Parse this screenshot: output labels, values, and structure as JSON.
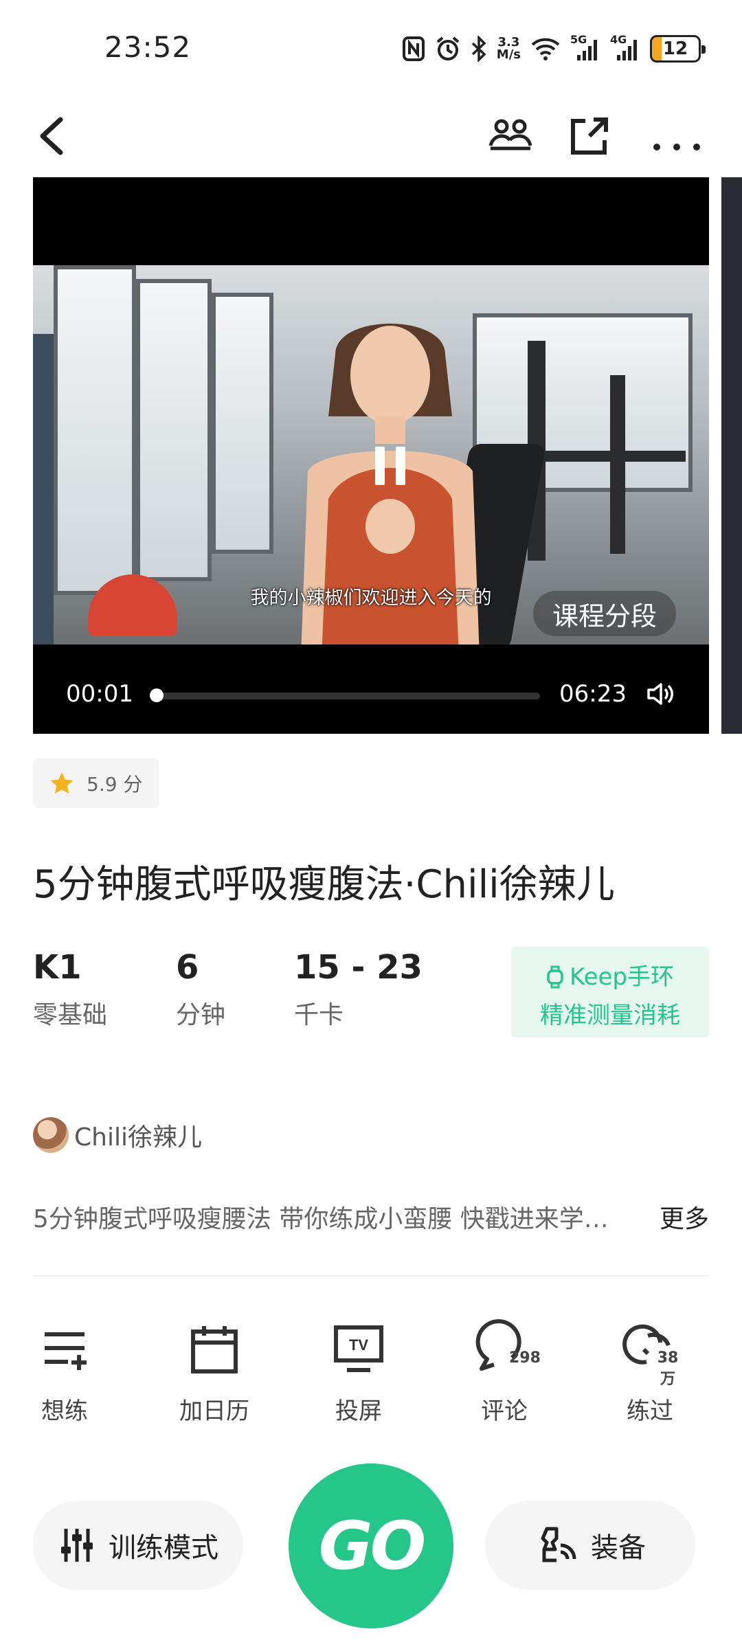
{
  "status_bar": {
    "time": "23:52",
    "net_speed_line1": "3.3",
    "net_speed_line2": "M/s",
    "net1": "5G",
    "net2": "4G",
    "battery": "12"
  },
  "video": {
    "subtitle": "我的小辣椒们欢迎进入今天的",
    "segments_label": "课程分段",
    "current_time": "00:01",
    "total_time": "06:23",
    "progress": 0.003
  },
  "rating": {
    "score": "5.9 分"
  },
  "course": {
    "title": "5分钟腹式呼吸瘦腹法·Chili徐辣儿",
    "stats": [
      {
        "value": "K1",
        "unit": "零基础"
      },
      {
        "value": "6",
        "unit": "分钟"
      },
      {
        "value": "15 - 23",
        "unit": "千卡"
      }
    ],
    "band_line1": "Keep手环",
    "band_line2": "精准测量消耗",
    "author": "Chili徐辣儿",
    "description": "5分钟腹式呼吸瘦腰法 带你练成小蛮腰 快戳进来学…",
    "more": "更多"
  },
  "actions": [
    {
      "label": "想练",
      "icon": "playlist-add-icon"
    },
    {
      "label": "加日历",
      "icon": "calendar-icon"
    },
    {
      "label": "投屏",
      "icon": "tv-cast-icon",
      "badge": "TV"
    },
    {
      "label": "评论",
      "icon": "comment-icon",
      "badge": "298"
    },
    {
      "label": "练过",
      "icon": "trained-icon",
      "badge": "38万"
    }
  ],
  "bottom": {
    "mode_label": "训练模式",
    "go_label": "GO",
    "equip_label": "装备"
  },
  "colors": {
    "accent": "#24c789",
    "band_bg": "#e6f7ef",
    "star": "#f5b21b"
  }
}
